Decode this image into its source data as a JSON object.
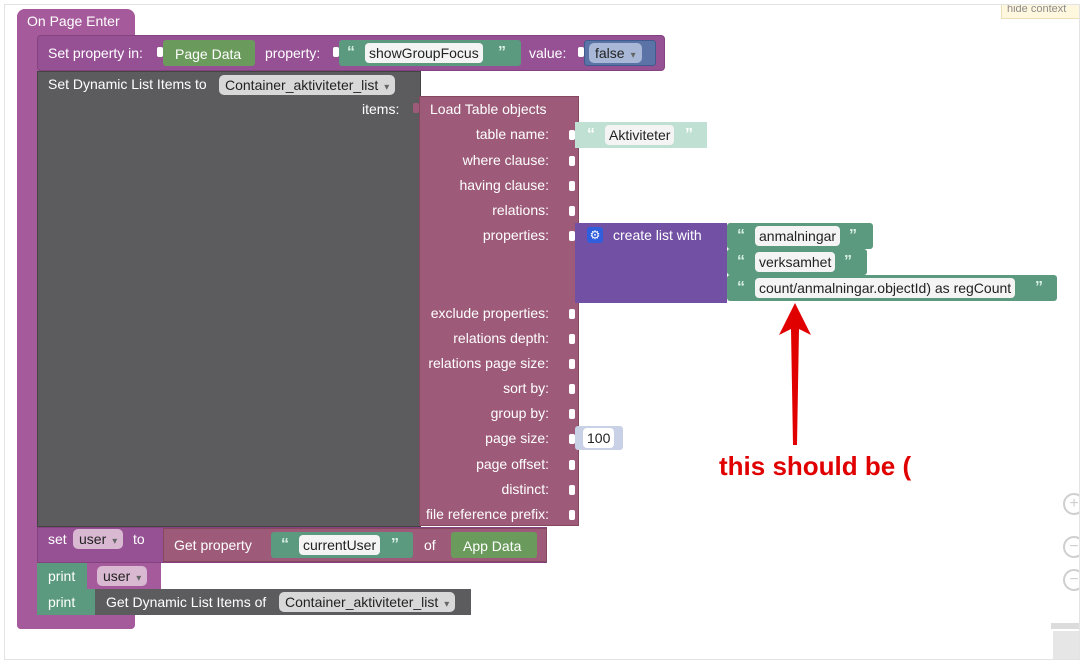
{
  "context_label": "hide context",
  "event": {
    "title": "On Page Enter"
  },
  "set_property": {
    "prefix": "Set property in:",
    "target": "Page Data",
    "property_label": "property:",
    "property_value": "showGroupFocus",
    "value_label": "value:",
    "value": "false"
  },
  "dynamic_list": {
    "prefix": "Set Dynamic List Items to",
    "container": "Container_aktiviteter_list",
    "items_label": "items:"
  },
  "load_table": {
    "title": "Load Table objects",
    "params": [
      "table name:",
      "where clause:",
      "having clause:",
      "relations:",
      "properties:",
      "exclude properties:",
      "relations depth:",
      "relations page size:",
      "sort by:",
      "group by:",
      "page size:",
      "page offset:",
      "distinct:",
      "file reference prefix:"
    ],
    "table_name_value": "Aktiviteter",
    "page_size_value": "100"
  },
  "create_list": {
    "label": "create list with",
    "items": [
      "anmalningar",
      "verksamhet",
      "count/anmalningar.objectId) as regCount"
    ]
  },
  "set_user": {
    "set_label": "set",
    "variable": "user",
    "to_label": "to",
    "get_label": "Get property",
    "property": "currentUser",
    "of_label": "of",
    "source": "App Data"
  },
  "print1": {
    "label": "print",
    "variable": "user"
  },
  "print2": {
    "label": "print",
    "get_label": "Get Dynamic List Items of",
    "container": "Container_aktiviteter_list"
  },
  "annotation": {
    "text": "this should be (",
    "color": "#e00000"
  },
  "zoom_controls": [
    "plus",
    "minus",
    "minus"
  ],
  "colors": {
    "event": "#a55b9b",
    "page_data": "#6a9b5c",
    "string": "#5b9a7f",
    "list": "#7251a4",
    "logic": "#5b73a6",
    "load_table": "#9d5b79",
    "dynamic_list": "#5c5c5f"
  }
}
